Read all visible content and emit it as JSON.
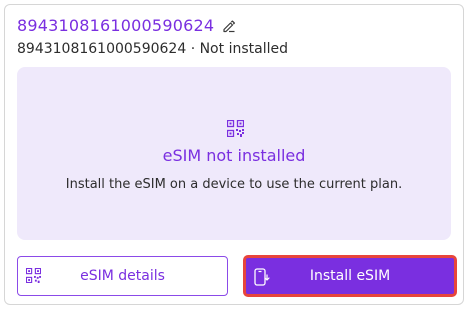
{
  "card": {
    "iccid": "8943108161000590624",
    "subtitle": "8943108161000590624 · Not installed"
  },
  "panel": {
    "icon": "qr-code-icon",
    "title": "eSIM not installed",
    "description": "Install the eSIM on a device to use the current plan."
  },
  "buttons": {
    "details_label": "eSIM details",
    "details_icon": "qr-code-icon",
    "install_label": "Install eSIM",
    "install_icon": "phone-download-icon"
  },
  "colors": {
    "accent": "#7a2fe0",
    "panel_bg": "#efe9fb",
    "focus_outline": "#e8453c"
  }
}
